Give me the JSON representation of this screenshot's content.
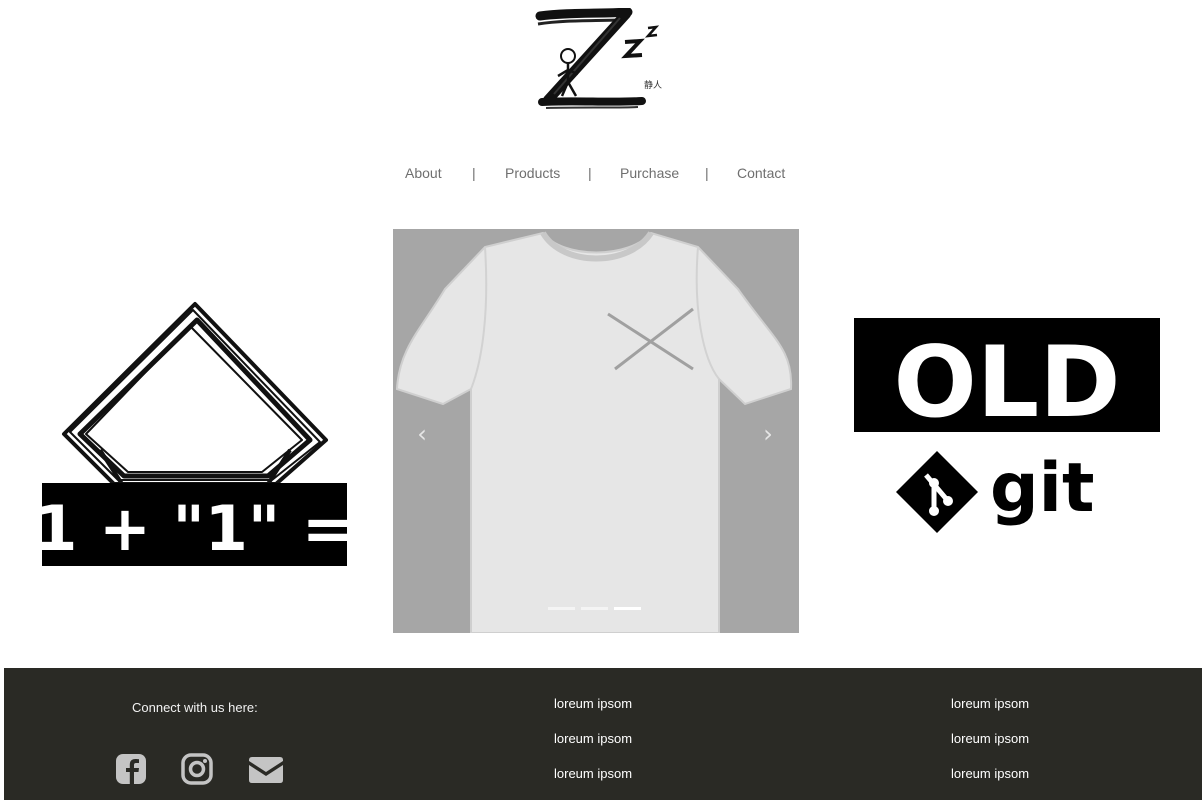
{
  "header": {
    "logo_text": "静人"
  },
  "nav": {
    "items": [
      {
        "label": "About"
      },
      {
        "label": "Products"
      },
      {
        "label": "Purchase"
      },
      {
        "label": "Contact"
      }
    ],
    "separator": "|"
  },
  "promo_left": {
    "equation": "1 + \"1\" ="
  },
  "carousel": {
    "prev_icon": "chevron-left-icon",
    "next_icon": "chevron-right-icon",
    "slide_count": 3,
    "active_index": 2
  },
  "promo_right": {
    "badge_text": "OLD",
    "brand_text": "git"
  },
  "footer": {
    "connect_heading": "Connect with us here:",
    "social_icons": [
      "facebook-icon",
      "instagram-icon",
      "envelope-icon"
    ],
    "column_2": [
      "loreum ipsom",
      "loreum ipsom",
      "loreum ipsom"
    ],
    "column_3": [
      "loreum ipsom",
      "loreum ipsom",
      "loreum ipsom"
    ]
  },
  "colors": {
    "footer_bg": "#2a2a25",
    "nav_text": "#6f6f6f",
    "social_icon": "#c4c4c4"
  }
}
